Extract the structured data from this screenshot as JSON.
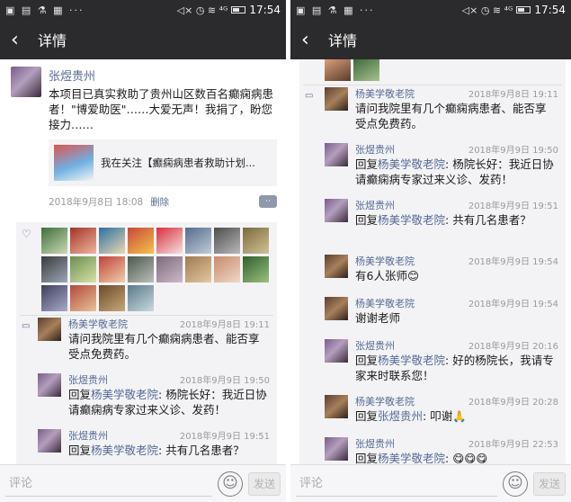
{
  "status_bar": {
    "left_icons": "▣ ▤ ⚗ ▦ ···",
    "right_icons": "◁× ◷ ≋ ⁴ᴳ",
    "time": "17:54"
  },
  "nav": {
    "back_icon": "‹",
    "title": "详情"
  },
  "post": {
    "author": "张煜贵州",
    "text": "本项目已真实救助了贵州山区数百名癫痫病患者！\"博爱助医\"……大爱无声！我捐了，盼您接力……",
    "link_title": "我在关注【癫痫病患者救助计划...",
    "time": "2018年9月8日 18:08",
    "delete_label": "删除",
    "more_label": "··"
  },
  "likes": {
    "icon": "♡",
    "count_shown": 21
  },
  "comments_left": [
    {
      "name": "杨美学敬老院",
      "time": "2018年9月8日 19:11",
      "text": "请问我院里有几个癫痫病患者、能否享受点免费药。"
    },
    {
      "name": "张煜贵州",
      "time": "2018年9月9日 19:50",
      "prefix": "回复",
      "ref": "杨美学敬老院",
      "text": ": 杨院长好：我近日协请癫痫病专家过来义诊、发药！"
    },
    {
      "name": "张煜贵州",
      "time": "2018年9月9日 19:51",
      "prefix": "回复",
      "ref": "杨美学敬老院",
      "text": ": 共有几名患者？"
    }
  ],
  "comments_right": [
    {
      "name": "杨美学敬老院",
      "time": "2018年9月8日 19:11",
      "text": "请问我院里有几个癫痫病患者、能否享受点免费药。"
    },
    {
      "name": "张煜贵州",
      "time": "2018年9月9日 19:50",
      "prefix": "回复",
      "ref": "杨美学敬老院",
      "text": ": 杨院长好：我近日协请癫痫病专家过来义诊、发药！"
    },
    {
      "name": "张煜贵州",
      "time": "2018年9月9日 19:51",
      "prefix": "回复",
      "ref": "杨美学敬老院",
      "text": ": 共有几名患者？"
    },
    {
      "name": "杨美学敬老院",
      "time": "2018年9月9日 19:54",
      "text": "有6人张师😊"
    },
    {
      "name": "杨美学敬老院",
      "time": "2018年9月9日 19:54",
      "text": "谢谢老师"
    },
    {
      "name": "张煜贵州",
      "time": "2018年9月9日 20:16",
      "prefix": "回复",
      "ref": "杨美学敬老院",
      "text": ": 好的杨院长，我请专家来时联系您！"
    },
    {
      "name": "杨美学敬老院",
      "time": "2018年9月9日 20:28",
      "prefix": "回复",
      "ref": "张煜贵州",
      "text": ": 叩谢🙏"
    },
    {
      "name": "张煜贵州",
      "time": "2018年9月9日 22:53",
      "prefix": "回复",
      "ref": "杨美学敬老院",
      "text": ": 😋😋😋"
    }
  ],
  "input": {
    "placeholder": "评论",
    "emoji_icon": "☺",
    "send_label": "发送"
  },
  "colors": {
    "bar": "#2b2b2d",
    "link_name": "#576b95",
    "comment_bg": "#f3f3f5"
  }
}
